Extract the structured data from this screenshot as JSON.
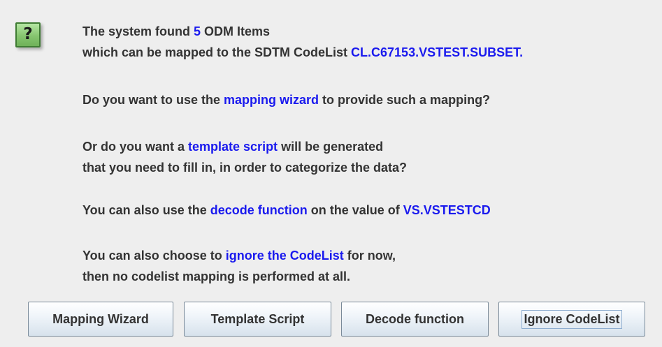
{
  "dialog": {
    "icon": "question-icon",
    "icon_glyph": "?",
    "message": {
      "line1": {
        "pre": "The system found ",
        "count": "5",
        "post": " ODM Items"
      },
      "line2": {
        "pre": "which can be mapped to the SDTM CodeList ",
        "codelist": "CL.C67153.VSTEST.SUBSET",
        "post": "."
      },
      "line3": {
        "pre": "Do you want to use the ",
        "wizard": "mapping wizard",
        "post": " to provide such a mapping?"
      },
      "line4": {
        "pre": "Or do you want a ",
        "template": "template script",
        "post": " will be generated"
      },
      "line5": {
        "text": "that you need to fill in, in order to categorize the data?"
      },
      "line6": {
        "pre": "You can also use the ",
        "decode": "decode function",
        "mid": " on the value of ",
        "variable": "VS.VSTESTCD"
      },
      "line7": {
        "pre": "You can also choose to ",
        "ignore": "ignore the CodeList",
        "post": " for now,"
      },
      "line8": {
        "text": "then no codelist mapping is performed at all."
      }
    },
    "buttons": {
      "mapping_wizard": "Mapping Wizard",
      "template_script": "Template Script",
      "decode_function": "Decode function",
      "ignore_codelist": "Ignore CodeList"
    },
    "colors": {
      "background": "#eeeeee",
      "text": "#333333",
      "highlight": "#1a1aee",
      "icon_green": "#86c56f"
    }
  }
}
